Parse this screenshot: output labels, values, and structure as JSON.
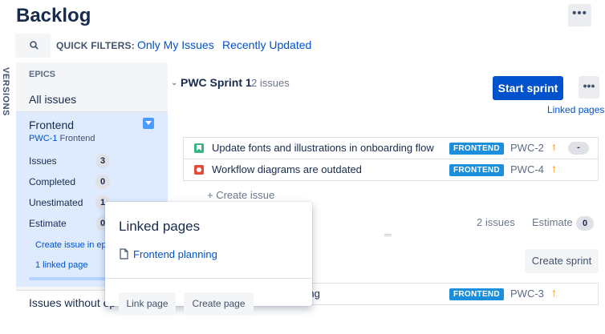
{
  "header": {
    "title": "Backlog",
    "more_label": "•••"
  },
  "quick_filters": {
    "label": "QUICK FILTERS:",
    "items": [
      "Only My Issues",
      "Recently Updated"
    ]
  },
  "side_tab": {
    "label": "VERSIONS"
  },
  "epics_panel": {
    "heading": "EPICS",
    "all_issues": "All issues",
    "epic": {
      "name": "Frontend",
      "key": "PWC-1",
      "key_suffix": "Frontend",
      "stats": [
        {
          "label": "Issues",
          "value": "3"
        },
        {
          "label": "Completed",
          "value": "0"
        },
        {
          "label": "Unestimated",
          "value": "1"
        },
        {
          "label": "Estimate",
          "value": "0"
        }
      ],
      "create_issue_link": "Create issue in ep",
      "linked_page_link": "1 linked page"
    },
    "issues_without_epic": "Issues without ep"
  },
  "sprint": {
    "name": "PWC Sprint 1",
    "issue_count": "2 issues",
    "start_button": "Start sprint",
    "more_label": "•••",
    "linked_pages": "Linked pages",
    "issues": [
      {
        "type": "story",
        "summary": "Update fonts and illustrations in onboarding flow",
        "epic": "FRONTEND",
        "key": "PWC-2",
        "priority": "↑",
        "estimate": "-"
      },
      {
        "type": "bug",
        "summary": "Workflow diagrams are outdated",
        "epic": "FRONTEND",
        "key": "PWC-4",
        "priority": "↑"
      }
    ],
    "create_issue": "+  Create issue"
  },
  "backlog": {
    "issue_count": "2 issues",
    "estimate_label": "Estimate",
    "estimate_value": "0",
    "create_sprint": "Create sprint",
    "issues": [
      {
        "summary_fragment": "king",
        "epic": "FRONTEND",
        "key": "PWC-3",
        "priority": "↑"
      }
    ]
  },
  "popup": {
    "title": "Linked pages",
    "page_link": "Frontend planning",
    "link_page_button": "Link page",
    "create_page_button": "Create page"
  },
  "colors": {
    "primary": "#0052cc",
    "epic_lozenge": "#1b8fdc",
    "priority": "#ff8b00",
    "selected_epic": "#deebff"
  }
}
